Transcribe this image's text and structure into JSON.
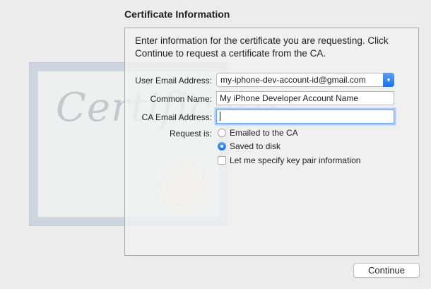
{
  "title": "Certificate Information",
  "intro": "Enter information for the certificate you are requesting. Click Continue to request a certificate from the CA.",
  "form": {
    "user_email": {
      "label": "User Email Address:",
      "value": "my-iphone-dev-account-id@gmail.com"
    },
    "common_name": {
      "label": "Common Name:",
      "value": "My iPhone Developer Account Name"
    },
    "ca_email": {
      "label": "CA Email Address:",
      "value": ""
    },
    "request_is": {
      "label": "Request is:",
      "options": [
        {
          "label": "Emailed to the CA",
          "selected": false
        },
        {
          "label": "Saved to disk",
          "selected": true
        }
      ]
    },
    "key_pair": {
      "label": "Let me specify key pair information",
      "checked": false
    }
  },
  "continue_label": "Continue",
  "graphic": {
    "text": "Certificate",
    "icons": [
      "certificate-graphic",
      "seal-icon",
      "chevron-updown-icon"
    ]
  },
  "colors": {
    "accent": "#1d6fe8",
    "focus_ring": "#a9cdf6"
  }
}
